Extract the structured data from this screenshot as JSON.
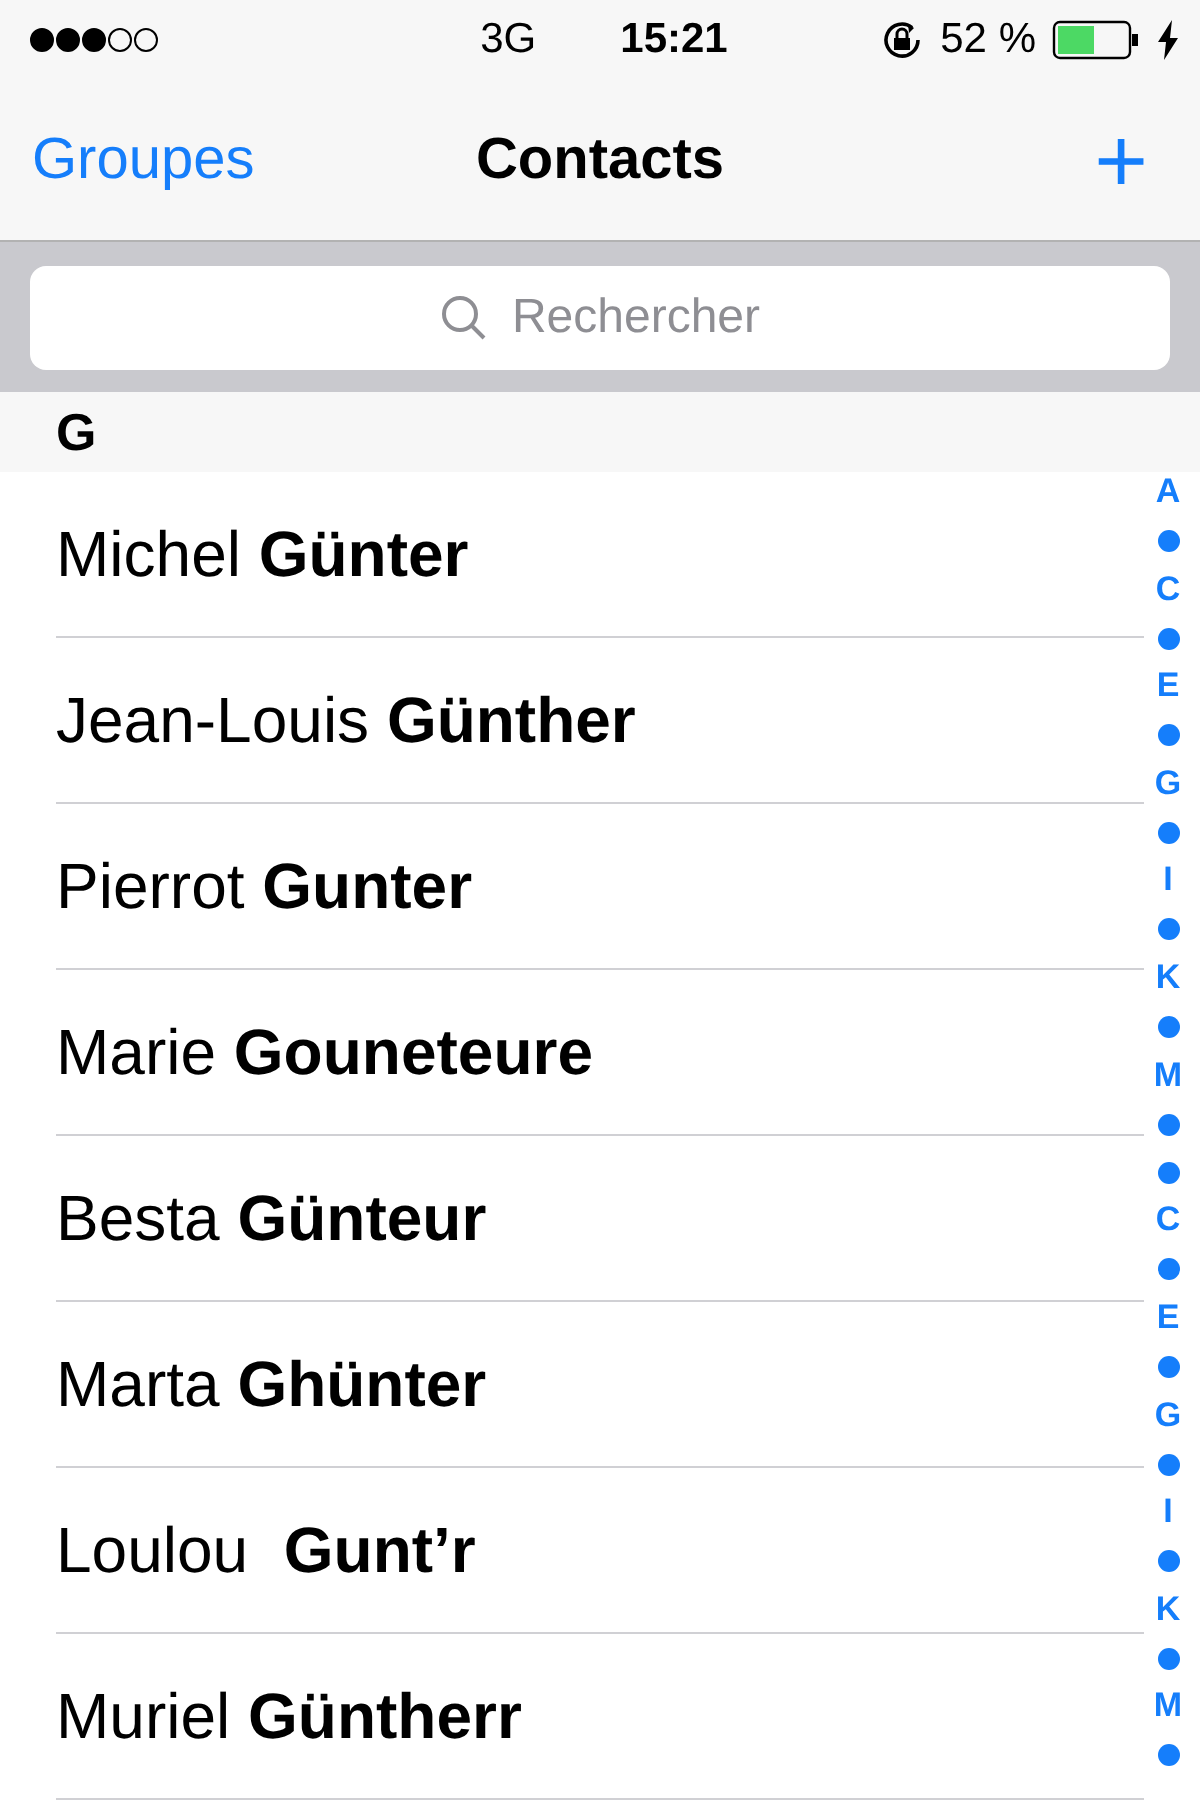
{
  "status_bar": {
    "network": "3G",
    "time": "15:21",
    "battery": "52 %"
  },
  "nav_bar": {
    "left": "Groupes",
    "title": "Contacts",
    "right": "+"
  },
  "search": {
    "placeholder": "Rechercher"
  },
  "section": {
    "header": "G",
    "contacts": [
      {
        "first": "Michel",
        "last": "Günter"
      },
      {
        "first": "Jean-Louis",
        "last": "Günther"
      },
      {
        "first": "Pierrot",
        "last": "Gunter"
      },
      {
        "first": "Marie",
        "last": "Gouneteure"
      },
      {
        "first": "Besta",
        "last": "Günteur"
      },
      {
        "first": "Marta",
        "last": "Ghünter"
      },
      {
        "first": "Loulou ",
        "last": "Gunt’r"
      },
      {
        "first": "Muriel",
        "last": "Güntherr"
      }
    ]
  },
  "index": [
    {
      "kind": "letter",
      "label": "A"
    },
    {
      "kind": "dot"
    },
    {
      "kind": "letter",
      "label": "C"
    },
    {
      "kind": "dot"
    },
    {
      "kind": "letter",
      "label": "E"
    },
    {
      "kind": "dot"
    },
    {
      "kind": "letter",
      "label": "G"
    },
    {
      "kind": "dot"
    },
    {
      "kind": "letter",
      "label": "I"
    },
    {
      "kind": "dot"
    },
    {
      "kind": "letter",
      "label": "K"
    },
    {
      "kind": "dot"
    },
    {
      "kind": "letter",
      "label": "M"
    },
    {
      "kind": "dot"
    },
    {
      "kind": "dot"
    },
    {
      "kind": "letter",
      "label": "C"
    },
    {
      "kind": "dot"
    },
    {
      "kind": "letter",
      "label": "E"
    },
    {
      "kind": "dot"
    },
    {
      "kind": "letter",
      "label": "G"
    },
    {
      "kind": "dot"
    },
    {
      "kind": "letter",
      "label": "I"
    },
    {
      "kind": "dot"
    },
    {
      "kind": "letter",
      "label": "K"
    },
    {
      "kind": "dot"
    },
    {
      "kind": "letter",
      "label": "M"
    },
    {
      "kind": "dot"
    }
  ]
}
